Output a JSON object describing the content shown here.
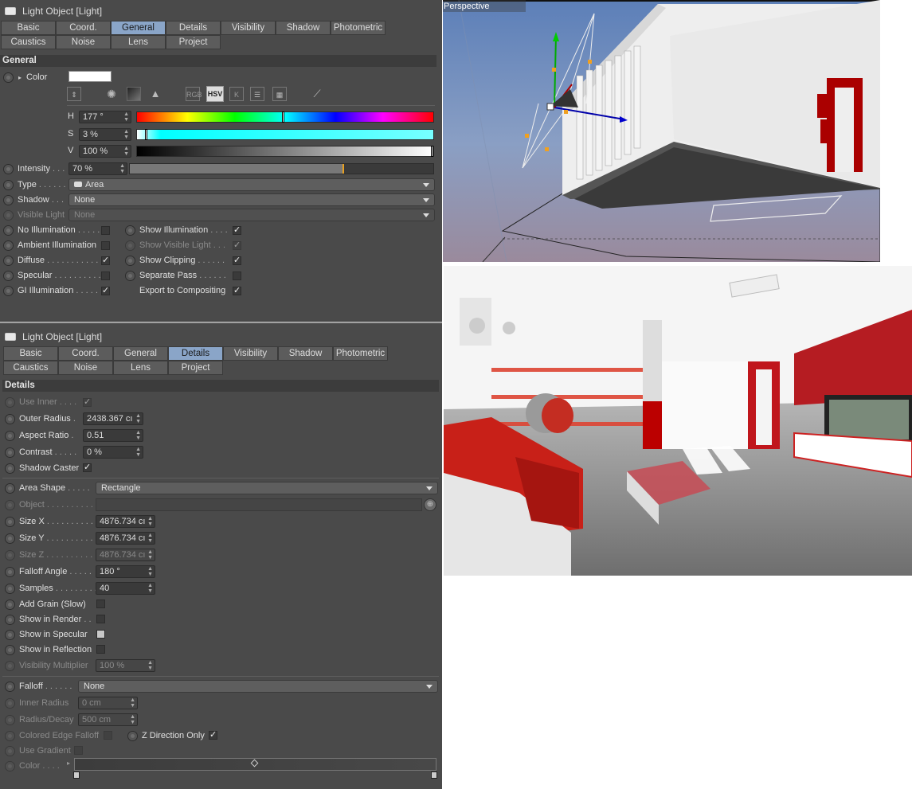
{
  "panel1": {
    "title": "Light Object [Light]",
    "tabs": [
      "Basic",
      "Coord.",
      "General",
      "Details",
      "Visibility",
      "Shadow",
      "Photometric",
      "Caustics",
      "Noise",
      "Lens",
      "Project"
    ],
    "active_tab": "General",
    "section": "General",
    "color_label": "Color",
    "color_swatch": "#ffffff",
    "mode_buttons": [
      "RGB",
      "HSV",
      "K"
    ],
    "h_label": "H",
    "h_value": "177 °",
    "s_label": "S",
    "s_value": "3 %",
    "v_label": "V",
    "v_value": "100 %",
    "intensity_label": "Intensity",
    "intensity_value": "70 %",
    "intensity_fraction": 0.7,
    "type_label": "Type",
    "type_value": "Area",
    "shadow_label": "Shadow",
    "shadow_value": "None",
    "visible_light_label": "Visible Light",
    "visible_light_value": "None",
    "left_checks": [
      {
        "label": "No Illumination",
        "checked": false
      },
      {
        "label": "Ambient Illumination",
        "checked": false
      },
      {
        "label": "Diffuse",
        "checked": true
      },
      {
        "label": "Specular",
        "checked": false
      },
      {
        "label": "GI Illumination",
        "checked": true
      }
    ],
    "right_checks": [
      {
        "label": "Show Illumination",
        "checked": true,
        "dim": false
      },
      {
        "label": "Show Visible Light",
        "checked": true,
        "dim": true
      },
      {
        "label": "Show Clipping",
        "checked": true,
        "dim": false
      },
      {
        "label": "Separate Pass",
        "checked": false,
        "dim": false
      },
      {
        "label": "Export to Compositing",
        "checked": true,
        "dim": false
      }
    ]
  },
  "panel2": {
    "title": "Light Object [Light]",
    "tabs": [
      "Basic",
      "Coord.",
      "General",
      "Details",
      "Visibility",
      "Shadow",
      "Photometric",
      "Caustics",
      "Noise",
      "Lens",
      "Project"
    ],
    "active_tab": "Details",
    "section": "Details",
    "use_inner": "Use Inner",
    "outer_radius_label": "Outer Radius",
    "outer_radius_value": "2438.367 cı",
    "aspect_ratio_label": "Aspect Ratio",
    "aspect_ratio_value": "0.51",
    "contrast_label": "Contrast",
    "contrast_value": "0 %",
    "shadow_caster": "Shadow Caster",
    "area_shape_label": "Area Shape",
    "area_shape_value": "Rectangle",
    "object_label": "Object",
    "size_x_label": "Size X",
    "size_x_value": "4876.734 cı",
    "size_y_label": "Size Y",
    "size_y_value": "4876.734 cı",
    "size_z_label": "Size Z",
    "size_z_value": "4876.734 cı",
    "falloff_angle_label": "Falloff Angle",
    "falloff_angle_value": "180 °",
    "samples_label": "Samples",
    "samples_value": "40",
    "add_grain": "Add Grain (Slow)",
    "show_in_render": "Show in Render",
    "show_in_specular": "Show in Specular",
    "show_in_reflection": "Show in Reflection",
    "visibility_multiplier_label": "Visibility Multiplier",
    "visibility_multiplier_value": "100 %",
    "falloff_label": "Falloff",
    "falloff_value": "None",
    "inner_radius_label": "Inner Radius",
    "inner_radius_value": "0 cm",
    "radius_decay_label": "Radius/Decay",
    "radius_decay_value": "500 cm",
    "colored_edge_label": "Colored Edge Falloff",
    "z_direction_label": "Z Direction Only",
    "use_gradient_label": "Use Gradient",
    "color_label": "Color"
  },
  "viewport": {
    "label": "Perspective"
  }
}
